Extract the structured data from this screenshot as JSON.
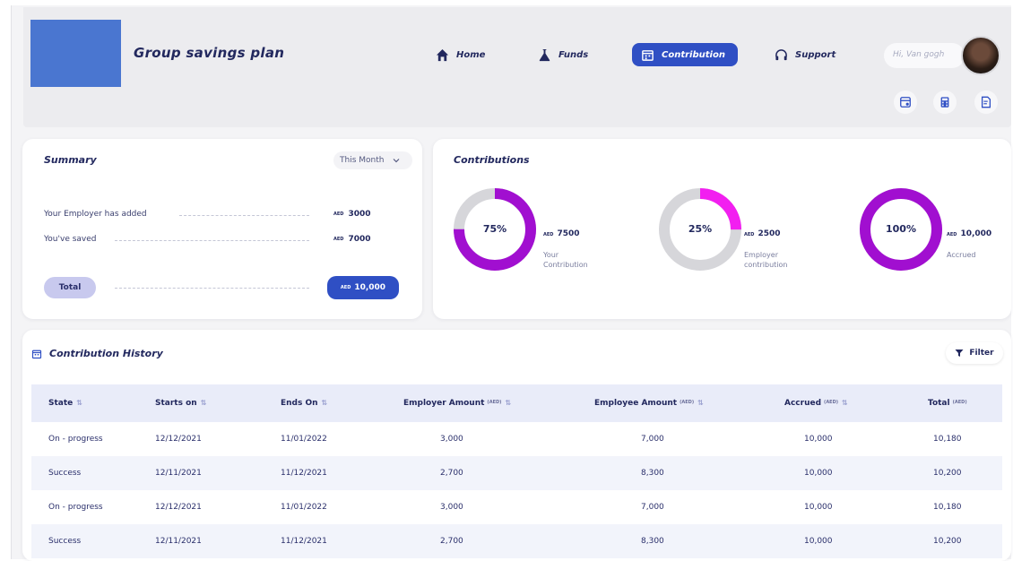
{
  "header": {
    "title": "Group savings plan",
    "nav": [
      {
        "label": "Home",
        "icon": "home-icon"
      },
      {
        "label": "Funds",
        "icon": "flask-icon"
      },
      {
        "label": "Contribution",
        "icon": "calendar-icon",
        "active": true
      },
      {
        "label": "Support",
        "icon": "headset-icon"
      }
    ],
    "greeting": "Hi, Van gogh",
    "tools": [
      "card-icon",
      "calculator-icon",
      "document-edit-icon"
    ]
  },
  "summary": {
    "title": "Summary",
    "period": "This Month",
    "employer_label": "Your Employer has added",
    "employer_currency": "AED",
    "employer_amount": "3000",
    "saved_label": "You've saved",
    "saved_currency": "AED",
    "saved_amount": "7000",
    "total_label": "Total",
    "total_currency": "AED",
    "total_amount": "10,000"
  },
  "contributions": {
    "title": "Contributions",
    "items": [
      {
        "percent": "75%",
        "fraction": 0.75,
        "currency": "AED",
        "amount": "7500",
        "caption1": "Your",
        "caption2": "Contribution"
      },
      {
        "percent": "25%",
        "fraction": 0.25,
        "currency": "AED",
        "amount": "2500",
        "caption1": "Employer",
        "caption2": "contribution"
      },
      {
        "percent": "100%",
        "fraction": 1.0,
        "currency": "AED",
        "amount": "10,000",
        "caption1": "Accrued",
        "caption2": ""
      }
    ],
    "colors": {
      "purple": "#a10fd0",
      "magenta": "#f21ff0",
      "track": "#d6d6da"
    }
  },
  "history": {
    "title": "Contribution History",
    "filter_label": "Filter",
    "columns": [
      "State",
      "Starts on",
      "Ends On",
      "Employer Amount",
      "Employee Amount",
      "Accrued",
      "Total"
    ],
    "column_currency": "(AED)",
    "rows": [
      [
        "On - progress",
        "12/12/2021",
        "11/01/2022",
        "3,000",
        "7,000",
        "10,000",
        "10,180"
      ],
      [
        "Success",
        "12/11/2021",
        "11/12/2021",
        "2,700",
        "8,300",
        "10,000",
        "10,200"
      ],
      [
        "On - progress",
        "12/12/2021",
        "11/01/2022",
        "3,000",
        "7,000",
        "10,000",
        "10,180"
      ],
      [
        "Success",
        "12/11/2021",
        "11/12/2021",
        "2,700",
        "8,300",
        "10,000",
        "10,200"
      ]
    ]
  },
  "colors": {
    "accent": "#2f4fc4",
    "text": "#22285e",
    "logo": "#4a76d0"
  }
}
